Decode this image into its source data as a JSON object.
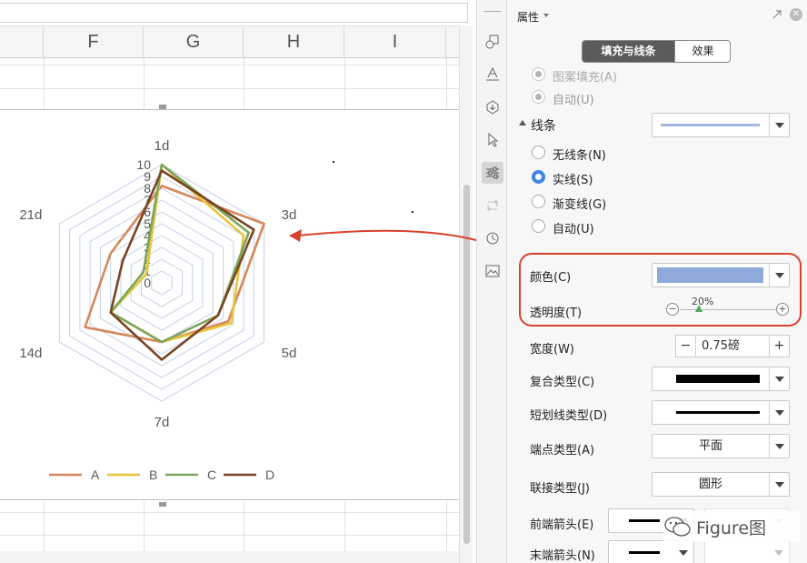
{
  "spreadsheet": {
    "columns": [
      "F",
      "G",
      "H",
      "I"
    ]
  },
  "chart_data": {
    "type": "radar",
    "categories": [
      "1d",
      "3d",
      "5d",
      "7d",
      "14d",
      "21d"
    ],
    "radial_ticks": [
      "0",
      "1",
      "2",
      "3",
      "4",
      "5",
      "6",
      "7",
      "8",
      "9",
      "10"
    ],
    "rlim": [
      0,
      10
    ],
    "series": [
      {
        "name": "A",
        "color": "#d4875a",
        "values": [
          8.2,
          10,
          6.5,
          5,
          7.5,
          5
        ]
      },
      {
        "name": "B",
        "color": "#e8c43a",
        "values": [
          10,
          8,
          6.8,
          5,
          5,
          1.5
        ]
      },
      {
        "name": "C",
        "color": "#7aa55a",
        "values": [
          10,
          8.5,
          5.5,
          5,
          5,
          1.8
        ]
      },
      {
        "name": "D",
        "color": "#7a4423",
        "values": [
          9.5,
          9,
          5.5,
          6.5,
          5,
          3.8
        ]
      }
    ],
    "legend": "bottom"
  },
  "toolbar": {
    "icons": [
      "shape-icon",
      "text-style-icon",
      "fill-icon",
      "cursor-icon",
      "settings-sliders-icon",
      "image-transform-icon",
      "history-icon",
      "image-icon"
    ]
  },
  "panel": {
    "title": "属性",
    "tabs": [
      "填充与线条",
      "效果"
    ],
    "fill_cut_label": "图案填充(A)",
    "fill_auto_label": "自动(U)",
    "line_section": "线条",
    "line_options": [
      "无线条(N)",
      "实线(S)",
      "渐变线(G)",
      "自动(U)"
    ],
    "color_label": "颜色(C)",
    "color_value": "#8eaadb",
    "transparency_label": "透明度(T)",
    "transparency_value": "20%",
    "transparency_fraction": 0.2,
    "width_label": "宽度(W)",
    "width_value": "0.75磅",
    "compound_label": "复合类型(C)",
    "dash_label": "短划线类型(D)",
    "cap_label": "端点类型(A)",
    "cap_value": "平面",
    "join_label": "联接类型(J)",
    "join_value": "圆形",
    "begin_arrow_label": "前端箭头(E)",
    "end_arrow_label": "末端箭头(N)"
  },
  "watermark": "Figure图",
  "colors": {
    "accent": "#3d84e0",
    "annotation": "#d9412e"
  }
}
